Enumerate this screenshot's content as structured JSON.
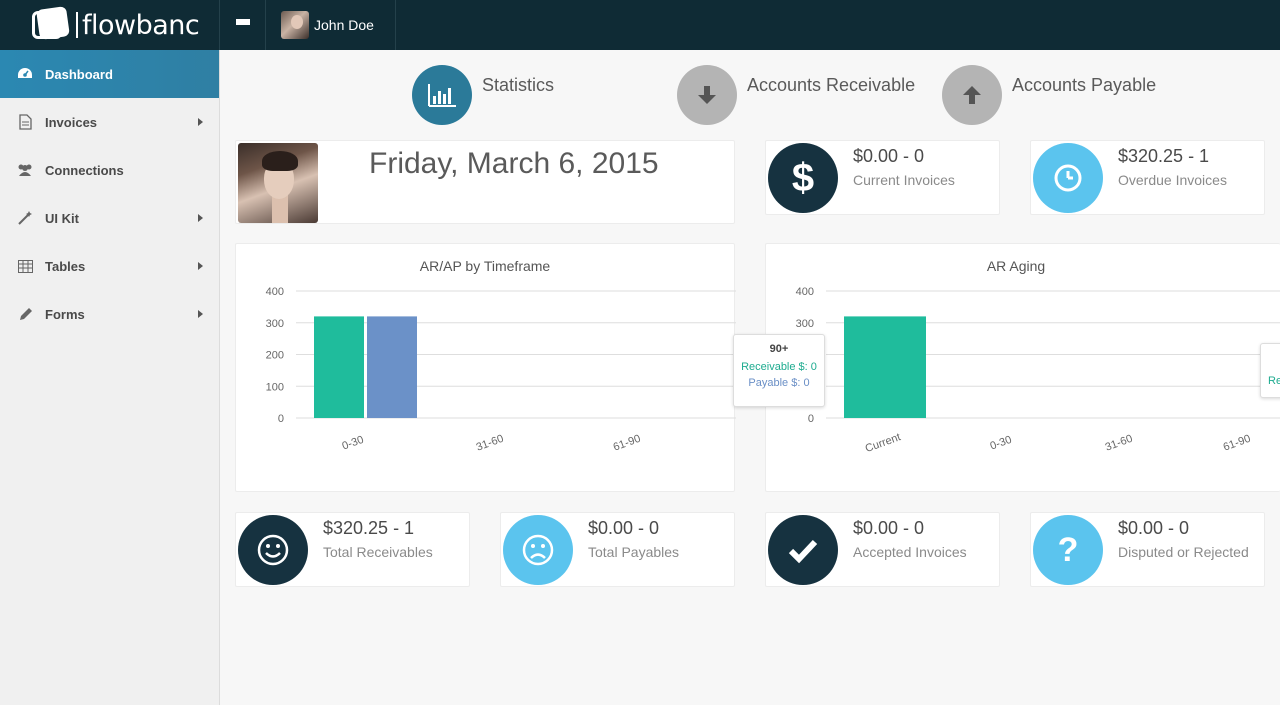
{
  "app": {
    "logo_text": "flowbanc",
    "user_name": "John Doe"
  },
  "sidebar": {
    "items": [
      {
        "label": "Dashboard",
        "icon": "dashboard-icon",
        "active": true,
        "has_submenu": false
      },
      {
        "label": "Invoices",
        "icon": "file-icon",
        "active": false,
        "has_submenu": true
      },
      {
        "label": "Connections",
        "icon": "users-icon",
        "active": false,
        "has_submenu": false
      },
      {
        "label": "UI Kit",
        "icon": "magic-wand-icon",
        "active": false,
        "has_submenu": true
      },
      {
        "label": "Tables",
        "icon": "table-icon",
        "active": false,
        "has_submenu": true
      },
      {
        "label": "Forms",
        "icon": "pencil-icon",
        "active": false,
        "has_submenu": true
      }
    ]
  },
  "tabs": [
    {
      "label": "Statistics",
      "icon": "bar-chart-icon",
      "active": true
    },
    {
      "label": "Accounts Receivable",
      "icon": "arrow-down-icon",
      "active": false
    },
    {
      "label": "Accounts Payable",
      "icon": "arrow-up-icon",
      "active": false
    }
  ],
  "date_card": {
    "date": "Friday, March 6, 2015"
  },
  "stats": {
    "current_invoices": {
      "value": "$0.00 - 0",
      "label": "Current Invoices",
      "icon": "dollar-icon"
    },
    "overdue_invoices": {
      "value": "$320.25 - 1",
      "label": "Overdue Invoices",
      "icon": "clock-icon"
    },
    "total_receivables": {
      "value": "$320.25 - 1",
      "label": "Total Receivables",
      "icon": "smile-icon"
    },
    "total_payables": {
      "value": "$0.00 - 0",
      "label": "Total Payables",
      "icon": "frown-icon"
    },
    "accepted_invoices": {
      "value": "$0.00 - 0",
      "label": "Accepted Invoices",
      "icon": "check-icon"
    },
    "disputed_invoices": {
      "value": "$0.00 - 0",
      "label": "Disputed or Rejected",
      "icon": "question-icon"
    }
  },
  "colors": {
    "receivable": "#1fbc9c",
    "payable": "#6b91c8",
    "dark_circle": "#163240",
    "light_circle": "#5bc4ee",
    "active_tab": "#2b7a99"
  },
  "tooltip": {
    "title": "90+",
    "receivable": "Receivable $: 0",
    "payable": "Payable $: 0"
  },
  "chart_data": [
    {
      "type": "bar",
      "title": "AR/AP by Timeframe",
      "categories": [
        "0-30",
        "31-60",
        "61-90",
        "90+"
      ],
      "series": [
        {
          "name": "Receivable",
          "values": [
            320,
            0,
            0,
            0
          ],
          "color": "#1fbc9c"
        },
        {
          "name": "Payable",
          "values": [
            320,
            0,
            0,
            0
          ],
          "color": "#6b91c8"
        }
      ],
      "ylim": [
        0,
        400
      ],
      "yticks": [
        0,
        100,
        200,
        300,
        400
      ],
      "grid": true
    },
    {
      "type": "bar",
      "title": "AR Aging",
      "categories": [
        "Current",
        "0-30",
        "31-60",
        "61-90"
      ],
      "series": [
        {
          "name": "Receivable",
          "values": [
            320,
            0,
            0,
            0
          ],
          "color": "#1fbc9c"
        }
      ],
      "ylim": [
        0,
        400
      ],
      "yticks": [
        0,
        100,
        200,
        300,
        400
      ],
      "grid": true
    }
  ]
}
